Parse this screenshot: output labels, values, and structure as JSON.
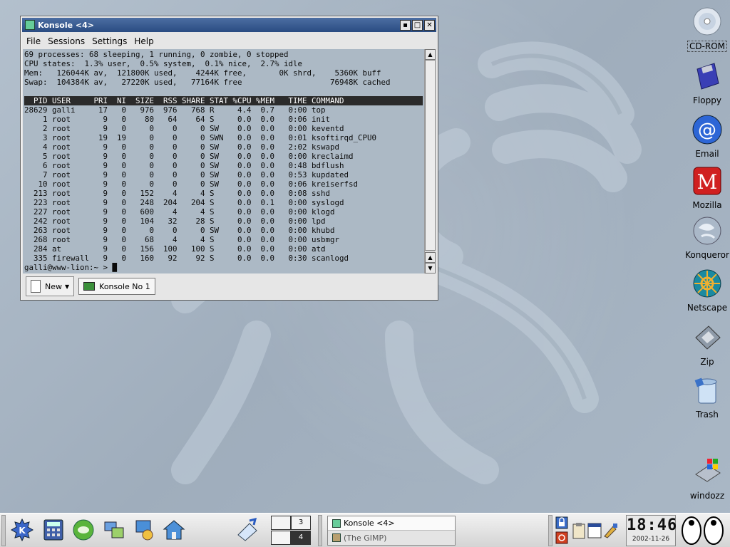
{
  "window": {
    "title": "Konsole <4>",
    "buttons": {
      "minimize": "▪",
      "maximize": "□",
      "close": "✕"
    },
    "menu": [
      "File",
      "Sessions",
      "Settings",
      "Help"
    ],
    "terminal_lines": [
      "69 processes: 68 sleeping, 1 running, 0 zombie, 0 stopped",
      "CPU states:  1.3% user,  0.5% system,  0.1% nice,  2.7% idle",
      "Mem:   126044K av,  121800K used,    4244K free,       0K shrd,    5360K buff",
      "Swap:  104384K av,   27220K used,   77164K free                   76948K cached",
      "",
      "  PID USER     PRI  NI  SIZE  RSS SHARE STAT %CPU %MEM   TIME COMMAND",
      "28629 galli     17   0   976  976   768 R     4.4  0.7   0:00 top",
      "    1 root       9   0    80   64    64 S     0.0  0.0   0:06 init",
      "    2 root       9   0     0    0     0 SW    0.0  0.0   0:00 keventd",
      "    3 root      19  19     0    0     0 SWN   0.0  0.0   0:01 ksoftirqd_CPU0",
      "    4 root       9   0     0    0     0 SW    0.0  0.0   2:02 kswapd",
      "    5 root       9   0     0    0     0 SW    0.0  0.0   0:00 kreclaimd",
      "    6 root       9   0     0    0     0 SW    0.0  0.0   0:48 bdflush",
      "    7 root       9   0     0    0     0 SW    0.0  0.0   0:53 kupdated",
      "   10 root       9   0     0    0     0 SW    0.0  0.0   0:06 kreiserfsd",
      "  213 root       9   0   152    4     4 S     0.0  0.0   0:08 sshd",
      "  223 root       9   0   248  204   204 S     0.0  0.1   0:00 syslogd",
      "  227 root       9   0   600    4     4 S     0.0  0.0   0:00 klogd",
      "  242 root       9   0   104   32    28 S     0.0  0.0   0:00 lpd",
      "  263 root       9   0     0    0     0 SW    0.0  0.0   0:00 khubd",
      "  268 root       9   0    68    4     4 S     0.0  0.0   0:00 usbmgr",
      "  284 at         9   0   156  100   100 S     0.0  0.0   0:00 atd",
      "  335 firewall   9   0   160   92    92 S     0.0  0.0   0:30 scanlogd",
      "galli@www-lion:~ > █"
    ],
    "tabs": {
      "new_label": "New",
      "session_label": "Konsole No 1"
    }
  },
  "desktop_icons": [
    {
      "label": "CD-ROM",
      "icon": "cdrom-icon"
    },
    {
      "label": "Floppy",
      "icon": "floppy-icon"
    },
    {
      "label": "Email",
      "icon": "email-icon"
    },
    {
      "label": "Mozilla",
      "icon": "mozilla-icon"
    },
    {
      "label": "Konqueror",
      "icon": "konqueror-icon"
    },
    {
      "label": "Netscape",
      "icon": "netscape-icon"
    },
    {
      "label": "Zip",
      "icon": "zip-icon"
    },
    {
      "label": "Trash",
      "icon": "trash-icon"
    },
    {
      "label": "windozz",
      "icon": "windozz-icon"
    }
  ],
  "panel": {
    "pager": [
      "3",
      "4"
    ],
    "tasks": [
      {
        "label": "Konsole <4>",
        "active": true
      },
      {
        "label": "(The GIMP)",
        "active": false
      }
    ],
    "clock": {
      "time": "18:46",
      "date": "2002-11-26"
    }
  },
  "colors": {
    "titlebar": "#2a4c82",
    "desktop": "#a7b5c4"
  }
}
